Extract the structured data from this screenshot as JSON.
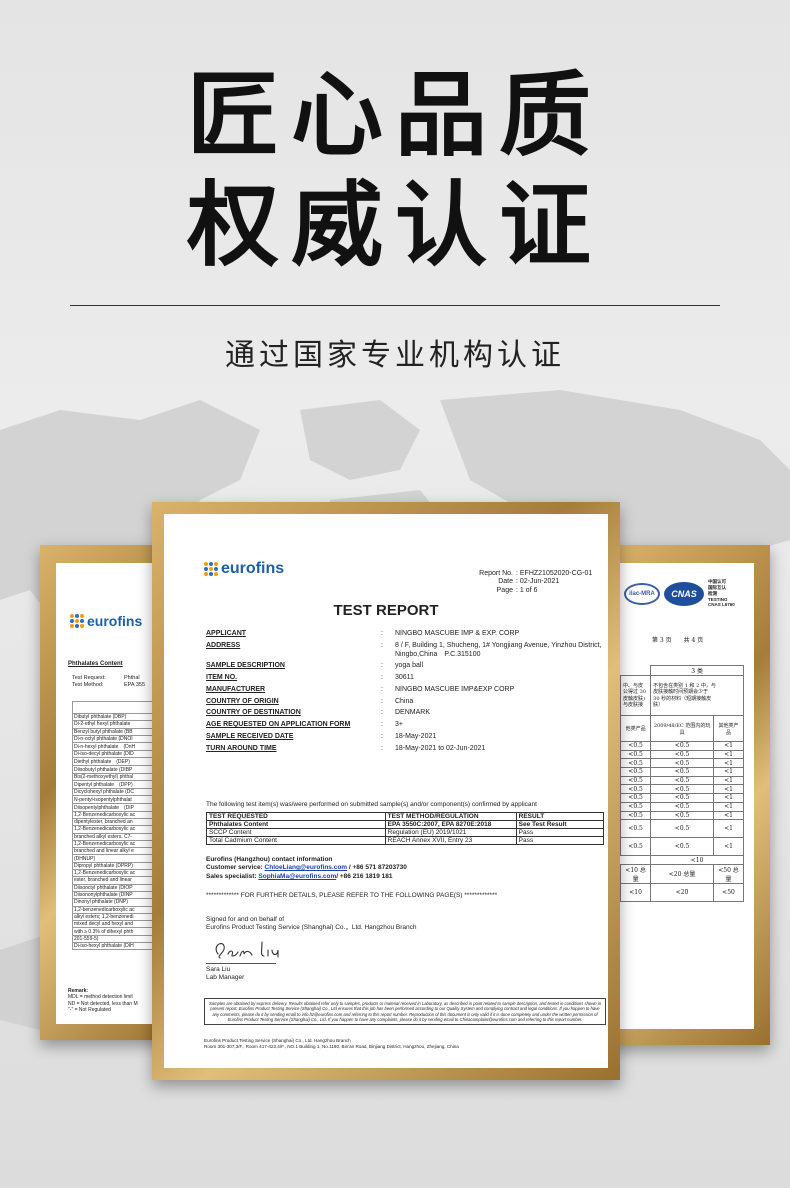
{
  "headline": {
    "line1": "匠心品质",
    "line2": "权威认证"
  },
  "subtitle": "通过国家专业机构认证",
  "left_report": {
    "logo": "eurofins",
    "section": "Phthalates Content",
    "test_request_label": "Test Request:",
    "test_request_value": "Phthal",
    "test_method_label": "Test Method:",
    "test_method_value": "EPA 355",
    "table_header": "Tested Item",
    "items": [
      "Dibutyl phthalate (DBP)",
      "Di-2-ethyl hexyl phthalate",
      "Benzyl butyl phthalate (BB",
      "Di-n-octyl phthalate (DNOI",
      "Di-n-hexyl phthalate　(DnH",
      "Di-iso-decyl phthalate (DID",
      "Diethyl phthalate　(DEP)",
      "Diisobutyl phthalate (DIBP",
      "Bis(2-methoxyethyl) phthal",
      "Dipentyl phthalate　(DPP)",
      "Dicyclohexyl phthalate (DC",
      "N-pentyl-isopentylphthalat",
      "Diisopentylphthalate　(DIP",
      "1,2-Benzenedicarboxylic ac",
      "dipentylester, branched an",
      "1,2-Benzenedicarboxylic ac",
      "branched alkyl esters, C7-",
      "1,2-Benzenedicarboxylic ac",
      "branched and linear alkyl e",
      "(DHNUP)",
      "Dipropyl phthalate (DPRP)",
      "1,2-Benzenedicarboxylic ac",
      "ester, branched and linear",
      "Diisooctyl phthalate (DIOP",
      "Diisononylphthalate (DINP",
      "Dinonyl phthalate (DNP)",
      "1,2-benzenedicarboxylic ac",
      "alkyl esters; 1,2-benzenedi",
      "mixed decyl and hexyl and",
      "with ≥ 0.3% of dihexyl phth",
      "201-559-5)",
      "Di-iso-hexyl phthalate (DIH"
    ],
    "remark_label": "Remark:",
    "remarks": [
      "MDL = method detection limit",
      "ND = Not detected, less than M",
      "\"-\" = Not Regulated"
    ]
  },
  "right_report": {
    "logo_ilac": "ilac-MRA",
    "logo_cnas": "CNAS",
    "cert_lines": [
      "中国认可",
      "国际互认",
      "检测",
      "TESTING",
      "CNAS L6760"
    ],
    "page_text": "第 3 页　　共 4 页",
    "header_cell": "3 类",
    "desc_left": [
      "中、与皮",
      "公得过 30",
      "皮触皮肤)",
      "与皮肤接"
    ],
    "desc_right": [
      "不包含在类别 1 和 2 中，与",
      "皮肤接触时间预期会少于",
      "30 秒的材料（短期接触皮",
      "肤）"
    ],
    "col_headers": [
      "他类产品",
      "2009/48/EC 范围内的玩具",
      "其他类产品"
    ],
    "rows": [
      [
        "<0.5",
        "<0.5",
        "<1"
      ],
      [
        "<0.5",
        "<0.5",
        "<1"
      ],
      [
        "<0.5",
        "<0.5",
        "<1"
      ],
      [
        "<0.5",
        "<0.5",
        "<1"
      ],
      [
        "<0.5",
        "<0.5",
        "<1"
      ],
      [
        "<0.5",
        "<0.5",
        "<1"
      ],
      [
        "<0.5",
        "<0.5",
        "<1"
      ],
      [
        "<0.5",
        "<0.5",
        "<1"
      ],
      [
        "<0.5",
        "<0.5",
        "<1"
      ]
    ],
    "big_rows": [
      [
        "<0.5",
        "<0.5",
        "<1"
      ],
      [
        "<0.5",
        "<0.5",
        "<1"
      ]
    ],
    "merged_row": "<10",
    "total_row1": [
      "<10 总量",
      "<20 总量",
      "<50 总量"
    ],
    "total_row2": [
      "<10",
      "<20",
      "<50"
    ]
  },
  "main_report": {
    "logo": "eurofins",
    "report_no_label": "Report No.",
    "report_no": ": EFHZ21052020-CG-01",
    "date_label": "Date",
    "date": ": 02-Jun-2021",
    "page_label": "Page",
    "page": ": 1 of 6",
    "title": "TEST REPORT",
    "fields": [
      {
        "label": "APPLICANT",
        "value": "NINGBO MASCUBE IMP & EXP. CORP"
      },
      {
        "label": "ADDRESS",
        "value": "8 / F, Building 1, Shucheng, 1# Yongjiang Avenue, Yinzhou District, Ningbo,China　P.C.315100"
      },
      {
        "label": "SAMPLE DESCRIPTION",
        "value": "yoga ball"
      },
      {
        "label": "ITEM NO.",
        "value": "30611"
      },
      {
        "label": "MANUFACTURER",
        "value": "NINGBO MASCUBE IMP&EXP CORP"
      },
      {
        "label": "COUNTRY OF ORIGIN",
        "value": "China"
      },
      {
        "label": "COUNTRY OF DESTINATION",
        "value": "DENMARK"
      },
      {
        "label": "AGE REQUESTED ON APPLICATION FORM",
        "value": "3+"
      },
      {
        "label": "SAMPLE RECEIVED DATE",
        "value": "18-May-2021"
      },
      {
        "label": "TURN AROUND TIME",
        "value": "18-May-2021 to 02-Jun-2021"
      }
    ],
    "intro": "The following test item(s) was/were performed on submitted sample(s) and/or component(s) confirmed by applicant",
    "results_headers": [
      "TEST REQUESTED",
      "TEST METHOD/REGULATION",
      "RESULT"
    ],
    "results": [
      [
        "Phthalates Content",
        "EPA 3550C:2007, EPA 8270E:2018",
        "See Test Result"
      ],
      [
        "SCCP Content",
        "Regulation (EU) 2019/1021",
        "Pass"
      ],
      [
        "Total Cadmium Content",
        "REACH Annex XVII, Entry 23",
        "Pass"
      ]
    ],
    "contact_title": "Eurofins (Hangzhou) contact information",
    "customer_service_label": "Customer service: ",
    "customer_service_email": "ChloeLiang@eurofins.com",
    "customer_service_phone": " / +86 571 87203730",
    "sales_label": "Sales specialist: ",
    "sales_email": "SophiaMa@eurofins.com",
    "sales_phone": "/ +86 216 1819 181",
    "further": "************* FOR FURTHER DETAILS, PLEASE REFER TO THE FOLLOWING PAGE(S) *************",
    "signed_line1": "Signed for and on behalf of",
    "signed_line2": "Eurofins Product Testing Service (Shanghai) Co.，Ltd. Hangzhou Branch",
    "signer_name": "Sara Liu",
    "signer_title": "Lab Manager",
    "disclaimer": "Samples are obtained by express delivery. Results obtained refer only to samples, products or material received in Laboratory, as described in point related to sample description, and tested in conditions shown in present report. Eurofins Product Testing Service (Shanghai) Co., Ltd ensures that this job has been performed according to our Quality System and complying contract and legal conditions. If you happen to have any comments, please do it by sending email to info.hz@eurofins.com and referring to this report number. Reproduction of this document is only valid if it is done completely and under the written permission of Eurofins Product Testing Service (Shanghai) Co., Ltd. If you happen to have any complaints, please do it by sending email to Chinacomplaint@eurofins.com and referring to this report number.",
    "footer_line1": "Eurofins Product Testing Service (Shanghai) Co., Ltd. Hangzhou Branch",
    "footer_line2": "Room 301-307,3/F., Room 417-422,4/F., NO.1 Building 1, No.1180, Bin'an Road, Binjiang District, Hangzhou, Zhejiang, China"
  }
}
